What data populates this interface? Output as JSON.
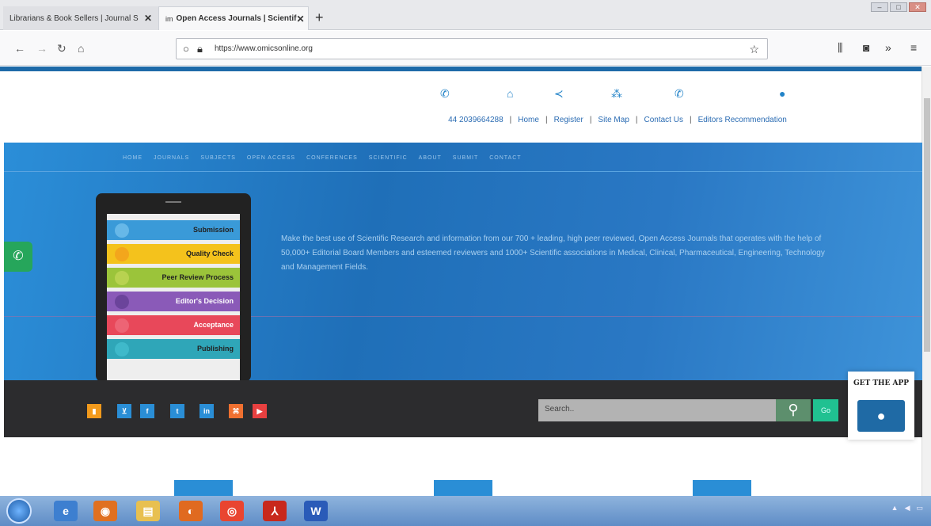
{
  "browser": {
    "tabs": [
      {
        "label": "Librarians & Book Sellers | Journal S"
      },
      {
        "label": "Open Access Journals | Scientif",
        "favicon": "im"
      }
    ],
    "new_tab": "+",
    "url": "https://www.omicsonline.org",
    "close_glyph": "✕"
  },
  "contact_bar": {
    "phone": "44 2039664288",
    "links": [
      "Home",
      "Register",
      "Site Map",
      "Contact Us",
      "Editors Recommendation"
    ],
    "separator": "|"
  },
  "hero": {
    "nav": [
      "HOME",
      "JOURNALS",
      "SUBJECTS",
      "OPEN ACCESS",
      "CONFERENCES",
      "SCIENTIFIC",
      "ABOUT",
      "SUBMIT",
      "CONTACT"
    ],
    "text": "Make the best use of Scientific Research and information from our 700 + leading, high peer reviewed, Open Access Journals that operates with the help of 50,000+ Editorial Board Members and esteemed reviewers and 1000+ Scientific associations in Medical, Clinical, Pharmaceutical, Engineering, Technology and Management Fields.",
    "process_steps": [
      "Submission",
      "Quality Check",
      "Peer Review Process",
      "Editor's Decision",
      "Acceptance",
      "Publishing"
    ]
  },
  "toolbar": {
    "search_placeholder": "Search..",
    "go_label": "Go"
  },
  "get_app": {
    "label": "GET THE APP"
  },
  "colors": {
    "accent": "#1e6aa8",
    "hero_blue": "#2a7fcc",
    "toolbar_dark": "#2c2c2e",
    "search_green": "#5d8f6d",
    "go_green": "#20c191"
  }
}
